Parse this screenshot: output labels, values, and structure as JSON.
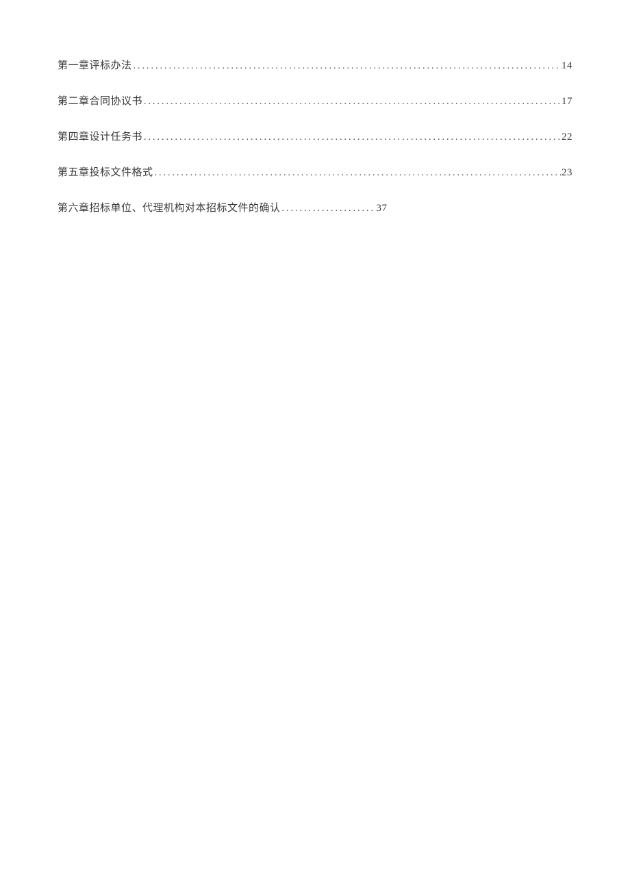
{
  "toc": {
    "entries": [
      {
        "title": "第一章评标办法",
        "page": "14",
        "full": true
      },
      {
        "title": "第二章合同协议书",
        "page": "17",
        "full": true
      },
      {
        "title": "第四章设计任务书",
        "page": "22",
        "full": true
      },
      {
        "title": "第五章投标文件格式",
        "page": "23",
        "full": true
      },
      {
        "title": "第六章招标单位、代理机构对本招标文件的确认",
        "page": "37",
        "full": false
      }
    ]
  }
}
